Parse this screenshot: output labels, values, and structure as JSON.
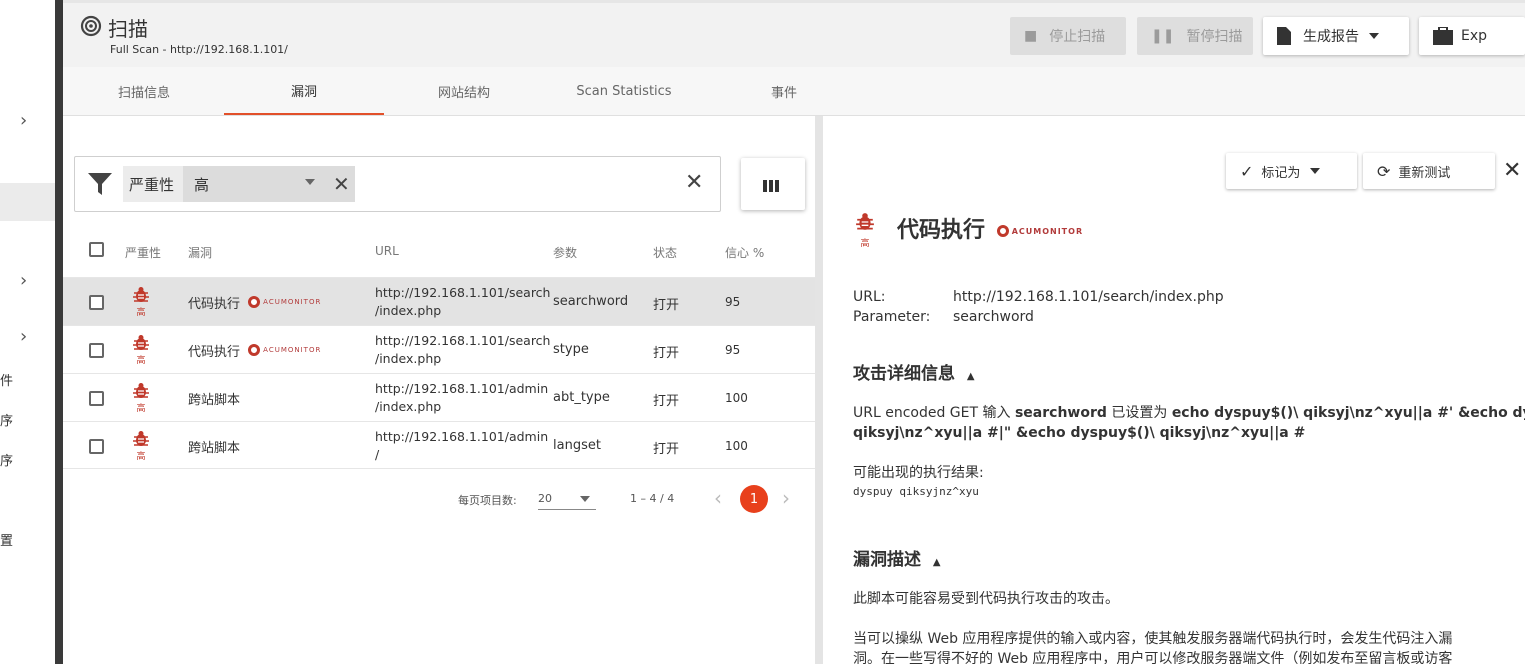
{
  "header": {
    "title": "扫描",
    "subtitle": "Full Scan - http://192.168.1.101/",
    "stop_label": "停止扫描",
    "pause_label": "暂停扫描",
    "report_label": "生成报告",
    "export_label": "Exp"
  },
  "tabs": [
    "扫描信息",
    "漏洞",
    "网站结构",
    "Scan Statistics",
    "事件"
  ],
  "sidebar": {
    "items": [
      "件",
      "序",
      "序",
      "置"
    ]
  },
  "filter": {
    "key": "严重性",
    "value": "高"
  },
  "table": {
    "headers": [
      "严重性",
      "漏洞",
      "URL",
      "参数",
      "状态",
      "信心 %"
    ],
    "severity_label": "高",
    "acumonitor": "ACUMONITOR",
    "rows": [
      {
        "name": "代码执行",
        "acu": true,
        "url1": "http://192.168.1.101/search",
        "url2": "/index.php",
        "param": "searchword",
        "status": "打开",
        "confidence": "95"
      },
      {
        "name": "代码执行",
        "acu": true,
        "url1": "http://192.168.1.101/search",
        "url2": "/index.php",
        "param": "stype",
        "status": "打开",
        "confidence": "95"
      },
      {
        "name": "跨站脚本",
        "acu": false,
        "url1": "http://192.168.1.101/admin",
        "url2": "/index.php",
        "param": "abt_type",
        "status": "打开",
        "confidence": "100"
      },
      {
        "name": "跨站脚本",
        "acu": false,
        "url1": "http://192.168.1.101/admin",
        "url2": "/",
        "param": "langset",
        "status": "打开",
        "confidence": "100"
      }
    ]
  },
  "pagination": {
    "per_page_label": "每页项目数:",
    "per_page": "20",
    "range": "1 – 4 / 4",
    "page": "1"
  },
  "detail": {
    "mark_label": "标记为",
    "retest_label": "重新测试",
    "title": "代码执行",
    "severity_label": "高",
    "url_label": "URL:",
    "url_value": "http://192.168.1.101/search/index.php",
    "param_label": "Parameter:",
    "param_value": "searchword",
    "attack_title": "攻击详细信息",
    "attack_pre": "URL encoded GET 输入 ",
    "attack_param": "searchword",
    "attack_mid": " 已设置为 ",
    "attack_payload1": "echo dyspuy$()\\ qiksyj\\nz^xyu||a #' &echo dyspuy$(",
    "attack_payload2": "qiksyj\\nz^xyu||a #|\" &echo dyspuy$()\\ qiksyj\\nz^xyu||a #",
    "result_label": "可能出现的执行结果:",
    "result_value": "dyspuy qiksyjnz^xyu",
    "desc_title": "漏洞描述",
    "desc1": "此脚本可能容易受到代码执行攻击的攻击。",
    "desc2": "当可以操纵 Web 应用程序提供的输入或内容，使其触发服务器端代码执行时，会发生代码注入漏",
    "desc3": "洞。在一些写得不好的 Web 应用程序中，用户可以修改服务器端文件（例如发布至留言板或访客"
  },
  "colors": {
    "accent": "#e2502a",
    "severity_high": "#c0392b",
    "page_active": "#e8401c"
  }
}
